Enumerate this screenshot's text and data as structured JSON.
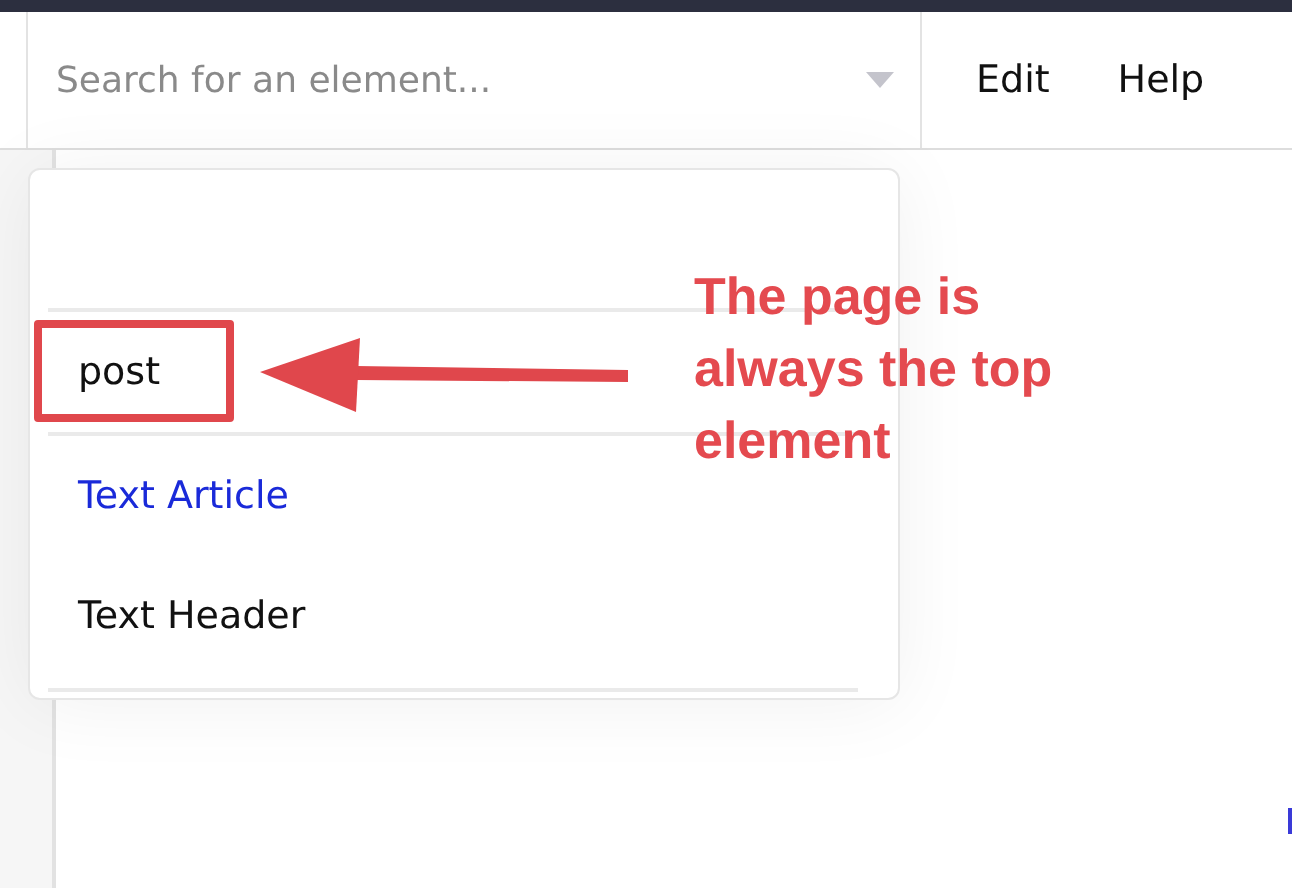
{
  "search": {
    "placeholder": "Search for an element..."
  },
  "menu": [
    {
      "label": "Edit"
    },
    {
      "label": "Help"
    }
  ],
  "dropdown": {
    "items": [
      {
        "label": "post",
        "selected": false,
        "annotated": true
      },
      {
        "label": "Text Article",
        "selected": true,
        "annotated": false
      },
      {
        "label": "Text Header",
        "selected": false,
        "annotated": false
      }
    ]
  },
  "annotation": {
    "text": "The page is always the top element"
  }
}
